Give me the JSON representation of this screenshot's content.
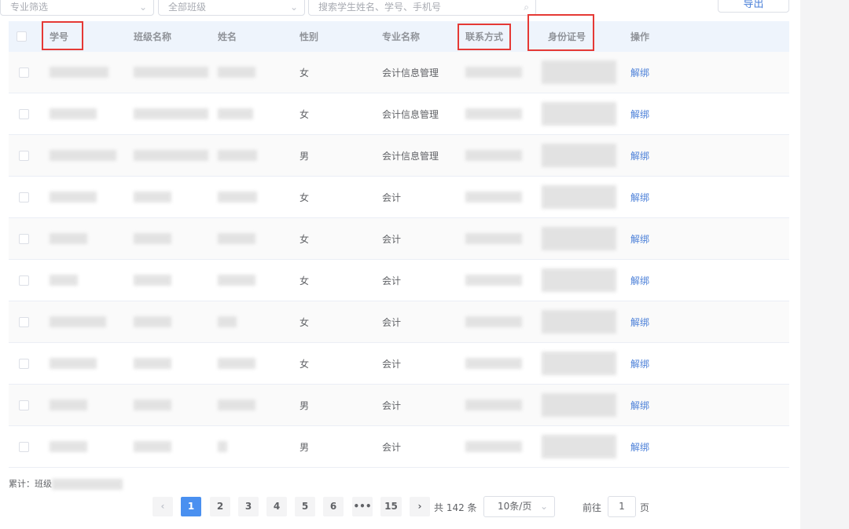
{
  "filters": {
    "major_placeholder": "专业筛选",
    "class_placeholder": "全部班级",
    "search_placeholder": "搜索学生姓名、学号、手机号",
    "export_label": "导出"
  },
  "table": {
    "headers": [
      "学号",
      "班级名称",
      "姓名",
      "性别",
      "专业名称",
      "联系方式",
      "身份证号",
      "操作"
    ],
    "rows": [
      {
        "gender": "女",
        "major": "会计信息管理",
        "action": "解绑"
      },
      {
        "gender": "女",
        "major": "会计信息管理",
        "action": "解绑"
      },
      {
        "gender": "男",
        "major": "会计信息管理",
        "action": "解绑"
      },
      {
        "gender": "女",
        "major": "会计",
        "action": "解绑"
      },
      {
        "gender": "女",
        "major": "会计",
        "action": "解绑"
      },
      {
        "gender": "女",
        "major": "会计",
        "action": "解绑"
      },
      {
        "gender": "女",
        "major": "会计",
        "action": "解绑"
      },
      {
        "gender": "女",
        "major": "会计",
        "action": "解绑"
      },
      {
        "gender": "男",
        "major": "会计",
        "action": "解绑"
      },
      {
        "gender": "男",
        "major": "会计",
        "action": "解绑"
      }
    ]
  },
  "summary": "累计：班级",
  "pagination": {
    "pages": [
      "1",
      "2",
      "3",
      "4",
      "5",
      "6",
      "•••",
      "15"
    ],
    "current": "1",
    "total": "共 142 条",
    "page_size": "10条/页",
    "goto_label": "前往",
    "goto_value": "1",
    "page_suffix": "页"
  }
}
